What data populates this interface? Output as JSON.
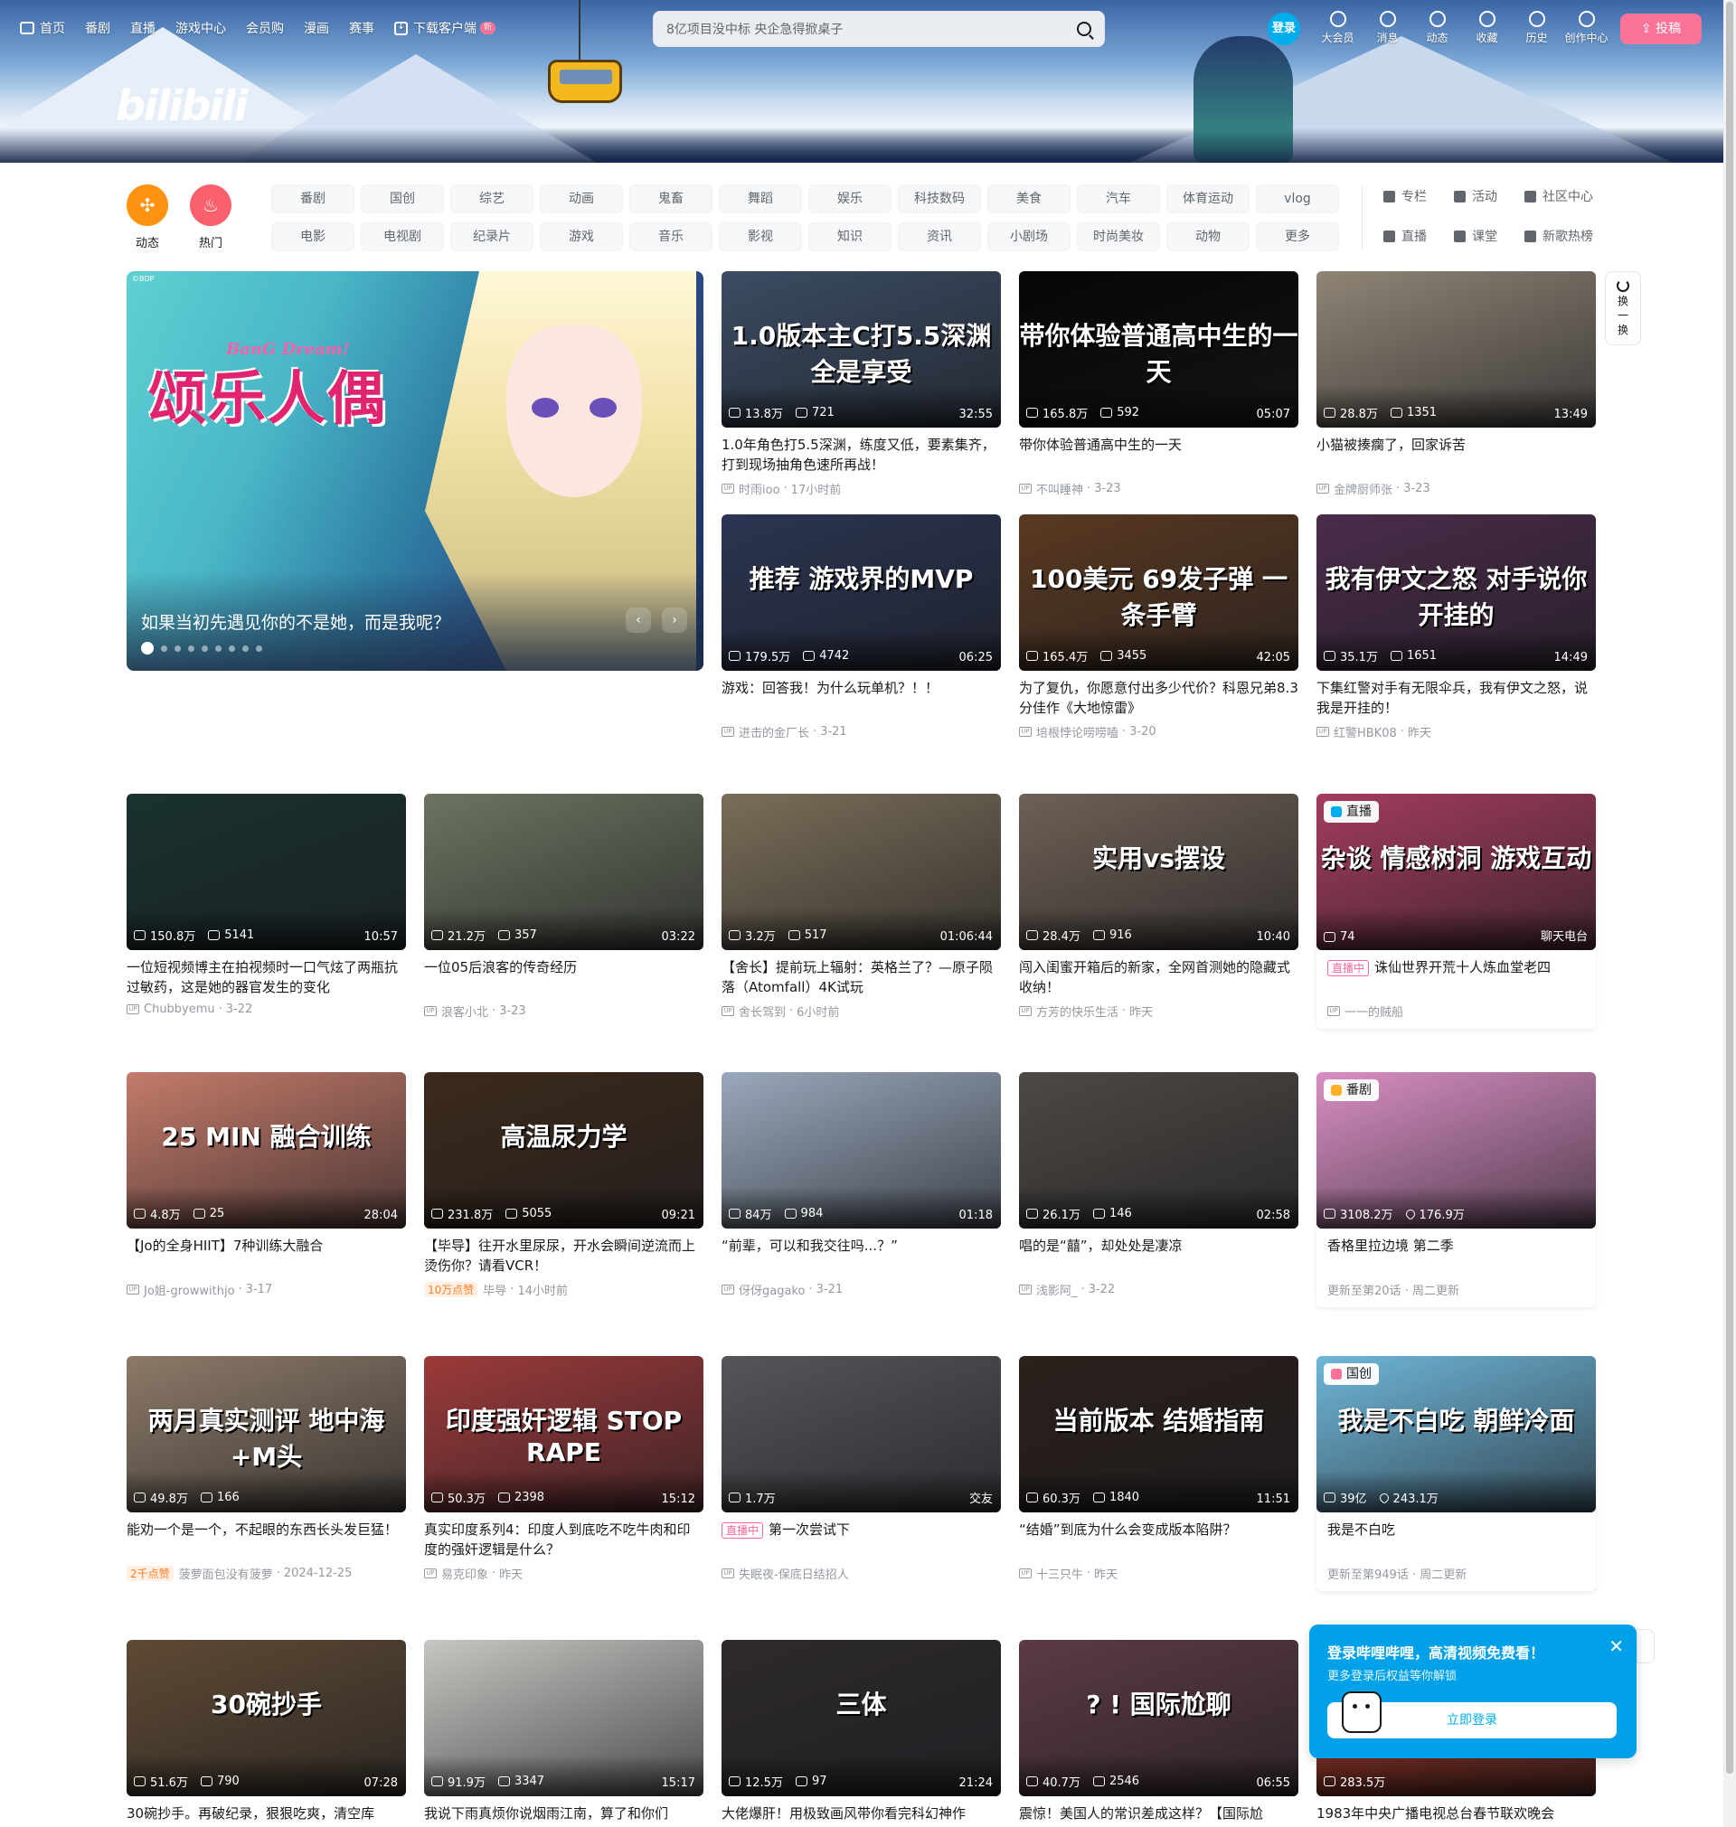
{
  "header": {
    "nav": [
      {
        "label": "首页",
        "icon": "tv-icon"
      },
      {
        "label": "番剧"
      },
      {
        "label": "直播"
      },
      {
        "label": "游戏中心"
      },
      {
        "label": "会员购"
      },
      {
        "label": "漫画"
      },
      {
        "label": "赛事"
      },
      {
        "label": "下载客户端",
        "icon": "download-icon",
        "badge": "新"
      }
    ],
    "search_placeholder": "8亿项目没中标 央企急得掀桌子",
    "login_label": "登录",
    "right_nav": [
      {
        "label": "大会员",
        "icon": "vip-icon"
      },
      {
        "label": "消息",
        "icon": "message-icon"
      },
      {
        "label": "动态",
        "icon": "dynamic-icon"
      },
      {
        "label": "收藏",
        "icon": "favorite-icon"
      },
      {
        "label": "历史",
        "icon": "history-icon"
      },
      {
        "label": "创作中心",
        "icon": "creator-icon"
      }
    ],
    "upload_label": "投稿",
    "brand_color": "#fb7299"
  },
  "channels": {
    "round": [
      {
        "label": "动态",
        "icon": "dynamic-icon",
        "color": "#ff9212"
      },
      {
        "label": "热门",
        "icon": "fire-icon",
        "color": "#f9616d"
      }
    ],
    "chips": [
      "番剧",
      "国创",
      "综艺",
      "动画",
      "鬼畜",
      "舞蹈",
      "娱乐",
      "科技数码",
      "美食",
      "汽车",
      "体育运动",
      "vlog",
      "电影",
      "电视剧",
      "纪录片",
      "游戏",
      "音乐",
      "影视",
      "知识",
      "资讯",
      "小剧场",
      "时尚美妆",
      "动物",
      "更多"
    ],
    "extras": [
      {
        "label": "专栏",
        "icon": "column-icon"
      },
      {
        "label": "活动",
        "icon": "activity-icon"
      },
      {
        "label": "社区中心",
        "icon": "community-icon"
      },
      {
        "label": "直播",
        "icon": "live-icon"
      },
      {
        "label": "课堂",
        "icon": "class-icon"
      },
      {
        "label": "新歌热榜",
        "icon": "music-chart-icon"
      }
    ]
  },
  "carousel": {
    "caption": "如果当初先遇见你的不是她，而是我呢？",
    "thumb_title": "颂乐人偶",
    "thumb_subtitle": "BanG Dream!",
    "copyright": "©BDP",
    "dots": 9,
    "active_dot": 0
  },
  "refresh_label": "换一换",
  "cards": [
    {
      "title": "1.0年角色打5.5深渊，练度又低，要素集齐，打到现场抽角色速所再战！",
      "up": "时雨ioo",
      "date": "17小时前",
      "views": "13.8万",
      "danmaku": "721",
      "duration": "32:55",
      "thumb_text": "1.0版本主C打5.5深渊 全是享受",
      "bg": "#3b4c63"
    },
    {
      "title": "带你体验普通高中生的一天",
      "up": "不叫睡神",
      "date": "3-23",
      "views": "165.8万",
      "danmaku": "592",
      "duration": "05:07",
      "thumb_text": "带你体验普通高中生的一天",
      "bg": "#050505"
    },
    {
      "title": "小猫被揍瘸了，回家诉苦",
      "up": "金牌厨师张",
      "date": "3-23",
      "views": "28.8万",
      "danmaku": "1351",
      "duration": "13:49",
      "thumb_text": "",
      "bg": "#8f8576"
    },
    {
      "title": "游戏：回答我！为什么玩单机？！！",
      "up": "进击的金厂长",
      "date": "3-21",
      "views": "179.5万",
      "danmaku": "4742",
      "duration": "06:25",
      "thumb_text": "推荐 游戏界的MVP",
      "bg": "#2b3552"
    },
    {
      "title": "为了复仇，你愿意付出多少代价？科恩兄弟8.3分佳作《大地惊雷》",
      "up": "培根悖论唠唠嗑",
      "date": "3-20",
      "views": "165.4万",
      "danmaku": "3455",
      "duration": "42:05",
      "thumb_text": "100美元 69发子弹 一条手臂",
      "bg": "#5a3920"
    },
    {
      "title": "下集红警对手有无限伞兵，我有伊文之怒，说我是开挂的！",
      "up": "红警HBK08",
      "date": "昨天",
      "views": "35.1万",
      "danmaku": "1651",
      "duration": "14:49",
      "thumb_text": "我有伊文之怒 对手说你开挂的",
      "bg": "#4a2c4a"
    },
    {
      "title": "一位短视频博主在拍视频时一口气炫了两瓶抗过敏药，这是她的器官发生的变化",
      "up": "Chubbyemu",
      "date": "3-22",
      "views": "150.8万",
      "danmaku": "5141",
      "duration": "10:57",
      "thumb_text": "",
      "bg": "#1a3230"
    },
    {
      "title": "一位05后浪客的传奇经历",
      "up": "浪客小北",
      "date": "3-23",
      "views": "21.2万",
      "danmaku": "357",
      "duration": "03:22",
      "thumb_text": "",
      "bg": "#6c7460"
    },
    {
      "title": "【舍长】提前玩上辐射：英格兰了？—原子陨落（Atomfall）4K试玩",
      "up": "舍长驾到",
      "date": "6小时前",
      "views": "3.2万",
      "danmaku": "517",
      "duration": "01:06:44",
      "thumb_text": "",
      "bg": "#7a6e58"
    },
    {
      "title": "闯入闺蜜开箱后的新家，全网首测她的隐藏式收纳！",
      "up": "方芳的快乐生活",
      "date": "昨天",
      "views": "28.4万",
      "danmaku": "916",
      "duration": "10:40",
      "thumb_text": "实用vs摆设",
      "bg": "#6e6055"
    },
    {
      "title": "诛仙世界开荒十人炼血堂老四",
      "up": "一一的贼船",
      "date": "",
      "views": "74",
      "danmaku": "",
      "duration": "聊天电台",
      "thumb_text": "杂谈 情感树洞 游戏互动",
      "bg": "#a33c5e",
      "badge": "直播",
      "live": true
    },
    {
      "title": "【Jo的全身HIIT】7种训练大融合",
      "up": "Jo姐-growwithjo",
      "date": "3-17",
      "views": "4.8万",
      "danmaku": "25",
      "duration": "28:04",
      "thumb_text": "25 MIN 融合训练",
      "bg": "#c47b6a"
    },
    {
      "title": "【毕导】往开水里尿尿，开水会瞬间逆流而上烫伤你？请看VCR！",
      "up": "毕导",
      "date": "14小时前",
      "views": "231.8万",
      "danmaku": "5055",
      "duration": "09:21",
      "thumb_text": "高温尿力学",
      "bg": "#3c2a1c",
      "hot": "10万点赞"
    },
    {
      "title": "“前辈，可以和我交往吗...？”",
      "up": "伢伢gagako",
      "date": "3-21",
      "views": "84万",
      "danmaku": "984",
      "duration": "01:18",
      "thumb_text": "",
      "bg": "#9aa8bb"
    },
    {
      "title": "唱的是“囍”，却处处是凄凉",
      "up": "浅影阿_",
      "date": "3-22",
      "views": "26.1万",
      "danmaku": "146",
      "duration": "02:58",
      "thumb_text": "",
      "bg": "#4d4944"
    },
    {
      "title": "香格里拉边境 第二季",
      "up": "",
      "date": "",
      "meta_text": "更新至第20话 · 周二更新",
      "views": "3108.2万",
      "danmaku": "176.9万",
      "duration": "",
      "thumb_text": "",
      "bg": "#d98fc3",
      "badge": "番剧",
      "heart": true
    },
    {
      "title": "能劝一个是一个，不起眼的东西长头发巨猛！",
      "up": "菠萝面包没有菠萝",
      "date": "2024-12-25",
      "views": "49.8万",
      "danmaku": "166",
      "duration": "",
      "thumb_text": "两月真实测评 地中海+M头",
      "bg": "#8c7a68",
      "hot": "2千点赞"
    },
    {
      "title": "真实印度系列4：印度人到底吃不吃牛肉和印度的强奸逻辑是什么？",
      "up": "易克印象",
      "date": "昨天",
      "views": "50.3万",
      "danmaku": "2398",
      "duration": "15:12",
      "thumb_text": "印度强奸逻辑 STOP RAPE",
      "bg": "#9c3a3a"
    },
    {
      "title": "第一次尝试下",
      "up": "失眠夜-保底日结招人",
      "date": "",
      "views": "1.7万",
      "danmaku": "",
      "duration": "交友",
      "thumb_text": "",
      "bg": "#56565a",
      "live": true
    },
    {
      "title": "“结婚”到底为什么会变成版本陷阱？",
      "up": "十三只牛",
      "date": "昨天",
      "views": "60.3万",
      "danmaku": "1840",
      "duration": "11:51",
      "thumb_text": "当前版本 结婚指南",
      "bg": "#2a201c"
    },
    {
      "title": "我是不白吃",
      "up": "",
      "date": "",
      "meta_text": "更新至第949话 · 周二更新",
      "views": "39亿",
      "danmaku": "243.1万",
      "duration": "",
      "thumb_text": "我是不白吃 朝鲜冷面",
      "bg": "#6fb6d8",
      "badge": "国创",
      "heart": true
    },
    {
      "title": "30碗抄手。再破纪录，狠狠吃爽，清空库",
      "up": "",
      "date": "",
      "views": "51.6万",
      "danmaku": "790",
      "duration": "07:28",
      "thumb_text": "30碗抄手",
      "bg": "#5e4a34"
    },
    {
      "title": "我说下雨真烦你说烟雨江南，算了和你们",
      "up": "",
      "date": "",
      "views": "91.9万",
      "danmaku": "3347",
      "duration": "15:17",
      "thumb_text": "",
      "bg": "#c8c6c2"
    },
    {
      "title": "大佬爆肝！用极致画风带你看完科幻神作",
      "up": "",
      "date": "",
      "views": "12.5万",
      "danmaku": "97",
      "duration": "21:24",
      "thumb_text": "三体",
      "bg": "#2e2a2c"
    },
    {
      "title": "震惊！美国人的常识差成这样？【国际尬",
      "up": "",
      "date": "",
      "views": "40.7万",
      "danmaku": "2546",
      "duration": "06:55",
      "thumb_text": "? ! 国际尬聊",
      "bg": "#5c3a46"
    },
    {
      "title": "1983年中央广播电视总台春节联欢晚会",
      "up": "",
      "date": "",
      "views": "283.5万",
      "danmaku": "",
      "duration": "",
      "thumb_text": "",
      "bg": "#b03a26"
    }
  ],
  "popup": {
    "title": "登录哔哩哔哩，高清视频免费看！",
    "subtitle": "更多登录后权益等你解锁",
    "button": "立即登录"
  }
}
